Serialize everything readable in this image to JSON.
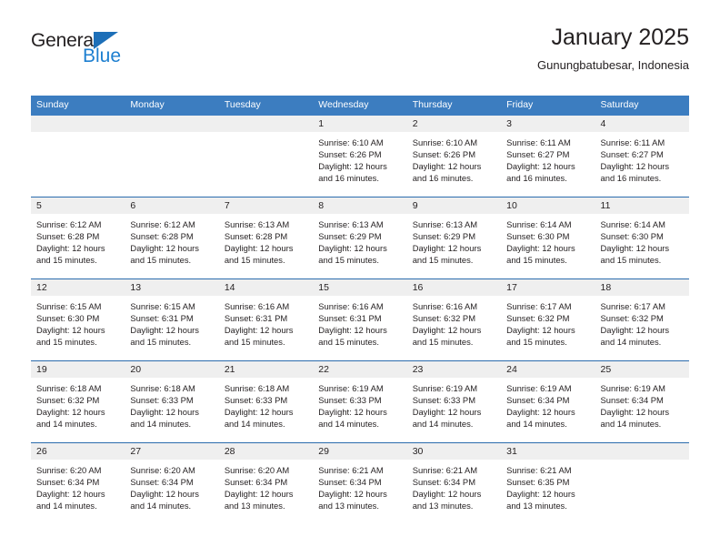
{
  "brand": {
    "name_top": "General",
    "name_bottom": "Blue",
    "triangle_color": "#1d6fb8",
    "text_color": "#1d7fd0"
  },
  "header": {
    "title": "January 2025",
    "subtitle": "Gunungbatubesar, Indonesia"
  },
  "theme": {
    "header_bg": "#3c7dc0",
    "row_divider": "#2b6cad",
    "daynum_bg": "#efefef",
    "text": "#231f20"
  },
  "weekdays": [
    "Sunday",
    "Monday",
    "Tuesday",
    "Wednesday",
    "Thursday",
    "Friday",
    "Saturday"
  ],
  "weeks": [
    [
      {
        "day": "",
        "empty": true
      },
      {
        "day": "",
        "empty": true
      },
      {
        "day": "",
        "empty": true
      },
      {
        "day": "1",
        "sunrise": "Sunrise: 6:10 AM",
        "sunset": "Sunset: 6:26 PM",
        "daylight_1": "Daylight: 12 hours",
        "daylight_2": "and 16 minutes."
      },
      {
        "day": "2",
        "sunrise": "Sunrise: 6:10 AM",
        "sunset": "Sunset: 6:26 PM",
        "daylight_1": "Daylight: 12 hours",
        "daylight_2": "and 16 minutes."
      },
      {
        "day": "3",
        "sunrise": "Sunrise: 6:11 AM",
        "sunset": "Sunset: 6:27 PM",
        "daylight_1": "Daylight: 12 hours",
        "daylight_2": "and 16 minutes."
      },
      {
        "day": "4",
        "sunrise": "Sunrise: 6:11 AM",
        "sunset": "Sunset: 6:27 PM",
        "daylight_1": "Daylight: 12 hours",
        "daylight_2": "and 16 minutes."
      }
    ],
    [
      {
        "day": "5",
        "sunrise": "Sunrise: 6:12 AM",
        "sunset": "Sunset: 6:28 PM",
        "daylight_1": "Daylight: 12 hours",
        "daylight_2": "and 15 minutes."
      },
      {
        "day": "6",
        "sunrise": "Sunrise: 6:12 AM",
        "sunset": "Sunset: 6:28 PM",
        "daylight_1": "Daylight: 12 hours",
        "daylight_2": "and 15 minutes."
      },
      {
        "day": "7",
        "sunrise": "Sunrise: 6:13 AM",
        "sunset": "Sunset: 6:28 PM",
        "daylight_1": "Daylight: 12 hours",
        "daylight_2": "and 15 minutes."
      },
      {
        "day": "8",
        "sunrise": "Sunrise: 6:13 AM",
        "sunset": "Sunset: 6:29 PM",
        "daylight_1": "Daylight: 12 hours",
        "daylight_2": "and 15 minutes."
      },
      {
        "day": "9",
        "sunrise": "Sunrise: 6:13 AM",
        "sunset": "Sunset: 6:29 PM",
        "daylight_1": "Daylight: 12 hours",
        "daylight_2": "and 15 minutes."
      },
      {
        "day": "10",
        "sunrise": "Sunrise: 6:14 AM",
        "sunset": "Sunset: 6:30 PM",
        "daylight_1": "Daylight: 12 hours",
        "daylight_2": "and 15 minutes."
      },
      {
        "day": "11",
        "sunrise": "Sunrise: 6:14 AM",
        "sunset": "Sunset: 6:30 PM",
        "daylight_1": "Daylight: 12 hours",
        "daylight_2": "and 15 minutes."
      }
    ],
    [
      {
        "day": "12",
        "sunrise": "Sunrise: 6:15 AM",
        "sunset": "Sunset: 6:30 PM",
        "daylight_1": "Daylight: 12 hours",
        "daylight_2": "and 15 minutes."
      },
      {
        "day": "13",
        "sunrise": "Sunrise: 6:15 AM",
        "sunset": "Sunset: 6:31 PM",
        "daylight_1": "Daylight: 12 hours",
        "daylight_2": "and 15 minutes."
      },
      {
        "day": "14",
        "sunrise": "Sunrise: 6:16 AM",
        "sunset": "Sunset: 6:31 PM",
        "daylight_1": "Daylight: 12 hours",
        "daylight_2": "and 15 minutes."
      },
      {
        "day": "15",
        "sunrise": "Sunrise: 6:16 AM",
        "sunset": "Sunset: 6:31 PM",
        "daylight_1": "Daylight: 12 hours",
        "daylight_2": "and 15 minutes."
      },
      {
        "day": "16",
        "sunrise": "Sunrise: 6:16 AM",
        "sunset": "Sunset: 6:32 PM",
        "daylight_1": "Daylight: 12 hours",
        "daylight_2": "and 15 minutes."
      },
      {
        "day": "17",
        "sunrise": "Sunrise: 6:17 AM",
        "sunset": "Sunset: 6:32 PM",
        "daylight_1": "Daylight: 12 hours",
        "daylight_2": "and 15 minutes."
      },
      {
        "day": "18",
        "sunrise": "Sunrise: 6:17 AM",
        "sunset": "Sunset: 6:32 PM",
        "daylight_1": "Daylight: 12 hours",
        "daylight_2": "and 14 minutes."
      }
    ],
    [
      {
        "day": "19",
        "sunrise": "Sunrise: 6:18 AM",
        "sunset": "Sunset: 6:32 PM",
        "daylight_1": "Daylight: 12 hours",
        "daylight_2": "and 14 minutes."
      },
      {
        "day": "20",
        "sunrise": "Sunrise: 6:18 AM",
        "sunset": "Sunset: 6:33 PM",
        "daylight_1": "Daylight: 12 hours",
        "daylight_2": "and 14 minutes."
      },
      {
        "day": "21",
        "sunrise": "Sunrise: 6:18 AM",
        "sunset": "Sunset: 6:33 PM",
        "daylight_1": "Daylight: 12 hours",
        "daylight_2": "and 14 minutes."
      },
      {
        "day": "22",
        "sunrise": "Sunrise: 6:19 AM",
        "sunset": "Sunset: 6:33 PM",
        "daylight_1": "Daylight: 12 hours",
        "daylight_2": "and 14 minutes."
      },
      {
        "day": "23",
        "sunrise": "Sunrise: 6:19 AM",
        "sunset": "Sunset: 6:33 PM",
        "daylight_1": "Daylight: 12 hours",
        "daylight_2": "and 14 minutes."
      },
      {
        "day": "24",
        "sunrise": "Sunrise: 6:19 AM",
        "sunset": "Sunset: 6:34 PM",
        "daylight_1": "Daylight: 12 hours",
        "daylight_2": "and 14 minutes."
      },
      {
        "day": "25",
        "sunrise": "Sunrise: 6:19 AM",
        "sunset": "Sunset: 6:34 PM",
        "daylight_1": "Daylight: 12 hours",
        "daylight_2": "and 14 minutes."
      }
    ],
    [
      {
        "day": "26",
        "sunrise": "Sunrise: 6:20 AM",
        "sunset": "Sunset: 6:34 PM",
        "daylight_1": "Daylight: 12 hours",
        "daylight_2": "and 14 minutes."
      },
      {
        "day": "27",
        "sunrise": "Sunrise: 6:20 AM",
        "sunset": "Sunset: 6:34 PM",
        "daylight_1": "Daylight: 12 hours",
        "daylight_2": "and 14 minutes."
      },
      {
        "day": "28",
        "sunrise": "Sunrise: 6:20 AM",
        "sunset": "Sunset: 6:34 PM",
        "daylight_1": "Daylight: 12 hours",
        "daylight_2": "and 13 minutes."
      },
      {
        "day": "29",
        "sunrise": "Sunrise: 6:21 AM",
        "sunset": "Sunset: 6:34 PM",
        "daylight_1": "Daylight: 12 hours",
        "daylight_2": "and 13 minutes."
      },
      {
        "day": "30",
        "sunrise": "Sunrise: 6:21 AM",
        "sunset": "Sunset: 6:34 PM",
        "daylight_1": "Daylight: 12 hours",
        "daylight_2": "and 13 minutes."
      },
      {
        "day": "31",
        "sunrise": "Sunrise: 6:21 AM",
        "sunset": "Sunset: 6:35 PM",
        "daylight_1": "Daylight: 12 hours",
        "daylight_2": "and 13 minutes."
      },
      {
        "day": "",
        "empty": true
      }
    ]
  ]
}
